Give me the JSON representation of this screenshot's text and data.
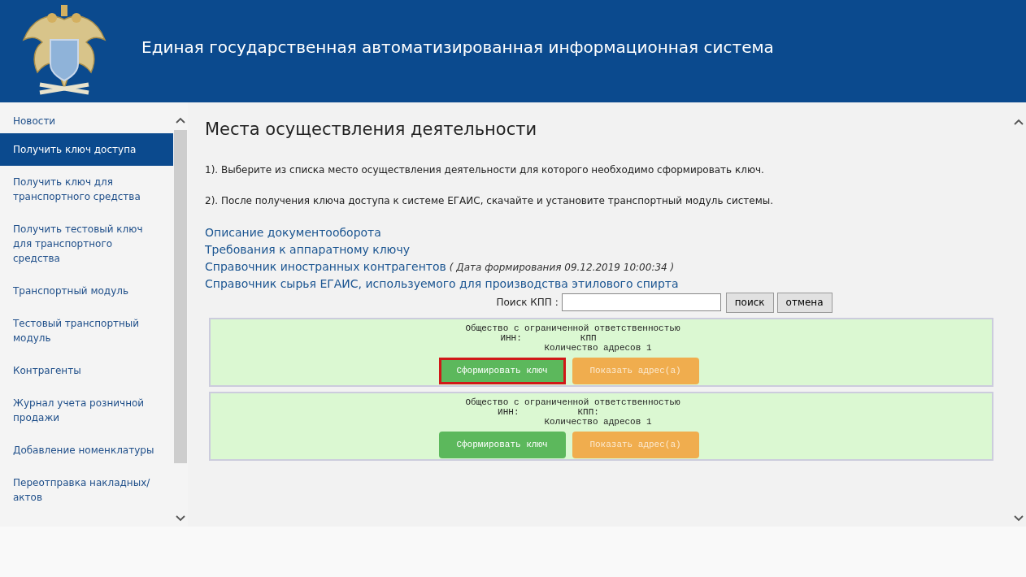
{
  "header": {
    "title": "Единая государственная автоматизированная информационная система"
  },
  "sidebar": {
    "items": [
      {
        "label": "Новости",
        "selected": false
      },
      {
        "label": "Получить ключ доступа",
        "selected": true
      },
      {
        "label": "Получить ключ для транспортного средства",
        "selected": false
      },
      {
        "label": "Получить тестовый ключ для транспортного средства",
        "selected": false
      },
      {
        "label": "Транспортный модуль",
        "selected": false
      },
      {
        "label": "Тестовый транспортный модуль",
        "selected": false
      },
      {
        "label": "Контрагенты",
        "selected": false
      },
      {
        "label": "Журнал учета розничной продажи",
        "selected": false
      },
      {
        "label": "Добавление номенклатуры",
        "selected": false
      },
      {
        "label": "Переотправка накладных/актов",
        "selected": false
      }
    ]
  },
  "main": {
    "title": "Места осуществления деятельности",
    "steps": [
      "1). Выберите из списка место осуществления деятельности для которого необходимо сформировать ключ.",
      "2). После получения ключа доступа к системе ЕГАИС, скачайте и установите транспортный модуль системы."
    ],
    "links": [
      {
        "label": "Описание документооборота"
      },
      {
        "label": "Требования к аппаратному ключу"
      },
      {
        "label": "Справочник иностранных контрагентов",
        "note": "( Дата формирования 09.12.2019 10:00:34 )"
      },
      {
        "label": "Справочник сырья ЕГАИС, используемого для производства этилового спирта"
      }
    ],
    "search": {
      "label": "Поиск КПП :",
      "search_button": "поиск",
      "cancel_button": "отмена"
    },
    "cards": [
      {
        "org": "Общество с ограниченной ответственностью",
        "inn": "ИНН:",
        "kpp": "КПП",
        "count": "Количество адресов 1",
        "key_button": "Сформировать ключ",
        "address_button": "Показать адрес(а)",
        "highlighted": true
      },
      {
        "org": "Общество с ограниченной ответственностью",
        "inn": "ИНН:",
        "kpp": "КПП:",
        "count": "Количество адресов 1",
        "key_button": "Сформировать ключ",
        "address_button": "Показать адрес(а)",
        "highlighted": false
      }
    ]
  }
}
